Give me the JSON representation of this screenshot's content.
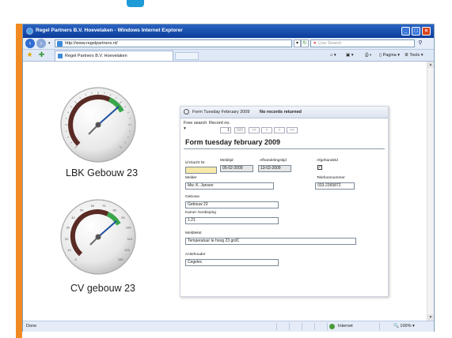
{
  "browser": {
    "window_title": "Regel Partners B.V. Hoevelaken - Windows Internet Explorer",
    "url": "http://www.regelpartners.nl/",
    "search_placeholder": "Live Search",
    "tab_title": "Regel Partners B.V. Hoevelaken",
    "commands": {
      "page": "Pagina",
      "tools": "Tools"
    },
    "status_left": "Done",
    "zone": "Internet",
    "zoom": "100%"
  },
  "gauges": [
    {
      "label": "LBK Gebouw 23",
      "ticks": [],
      "needle_fraction": 0.55
    },
    {
      "label": "CV gebouw 23",
      "ticks": [
        "0",
        "10",
        "20",
        "30",
        "40",
        "50",
        "60",
        "70",
        "80",
        "90",
        "100",
        "110",
        "120",
        "130"
      ],
      "needle_fraction": 0.55
    }
  ],
  "form": {
    "header_title": "Form Tuesday February 2009",
    "header_status": "No records returned",
    "free_search_label": "Free search",
    "record_no_label": "Record no.",
    "record_no_value": "1",
    "nav_go": "GO",
    "nav_first": "<<",
    "nav_prev": "<",
    "nav_next": ">",
    "nav_last": ">>",
    "title": "Form tuesday february 2009",
    "fields": {
      "id_klacht": {
        "label": "id Klacht Nr",
        "value": ""
      },
      "meldtijd": {
        "label": "Meldtijd",
        "value": "05-02-2009"
      },
      "afhandelingstijd": {
        "label": "Afhandelingstijd",
        "value": "13-02-2009"
      },
      "afgehandeld": {
        "label": "Afgehandeld",
        "checked": true
      },
      "melder": {
        "label": "Melder",
        "value": "Mw. K. Jansen"
      },
      "telefoonnummer": {
        "label": "Telefoonnummer",
        "value": "033-2365872"
      },
      "gebouw": {
        "label": "Gebouw",
        "value": "Gebouw 23"
      },
      "kamer": {
        "label": "Kamer /verdieping",
        "value": "1.21"
      },
      "meldtekst": {
        "label": "Meldtekst",
        "value": "Temperatuur te hoog 23 grdC"
      },
      "actiehouder": {
        "label": "Actiehouder",
        "value": "Cegelec"
      }
    }
  },
  "colors": {
    "accent_orange": "#f28a24",
    "titlebar_blue": "#0b3d9a",
    "gauge_arc_dark": "#5a2a24",
    "gauge_arc_green": "#3aa64a"
  }
}
